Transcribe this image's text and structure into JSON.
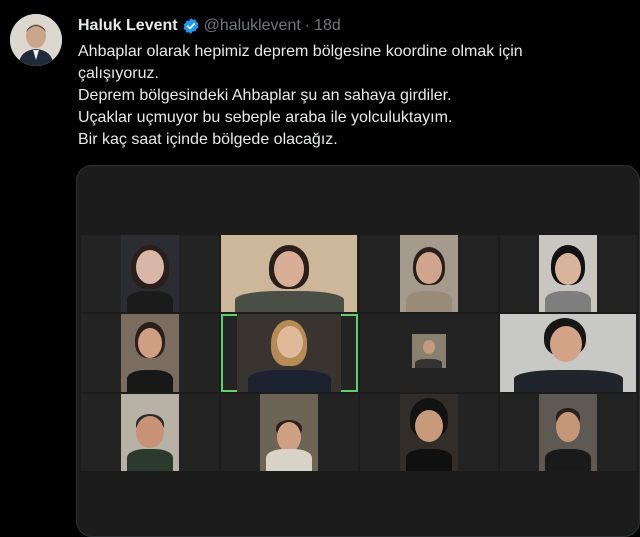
{
  "author": {
    "name": "Haluk Levent",
    "handle": "@haluklevent",
    "separator": "·",
    "time": "18d"
  },
  "tweet": {
    "lines": [
      "Ahbaplar olarak hepimiz deprem bölgesine koordine olmak için",
      "çalışıyoruz.",
      "Deprem bölgesindeki Ahbaplar şu an sahaya girdiler.",
      "Uçaklar uçmuyor bu sebeple araba ile yolculuktayım.",
      "Bir kaç saat içinde bölgede olacağız."
    ]
  },
  "colors": {
    "background": "#000000",
    "text": "#e7e9ea",
    "muted": "#71767b",
    "verified": "#1d9bf0",
    "active_speaker": "#5fcf6b"
  },
  "icons": {
    "verified": "verified-badge-icon"
  }
}
